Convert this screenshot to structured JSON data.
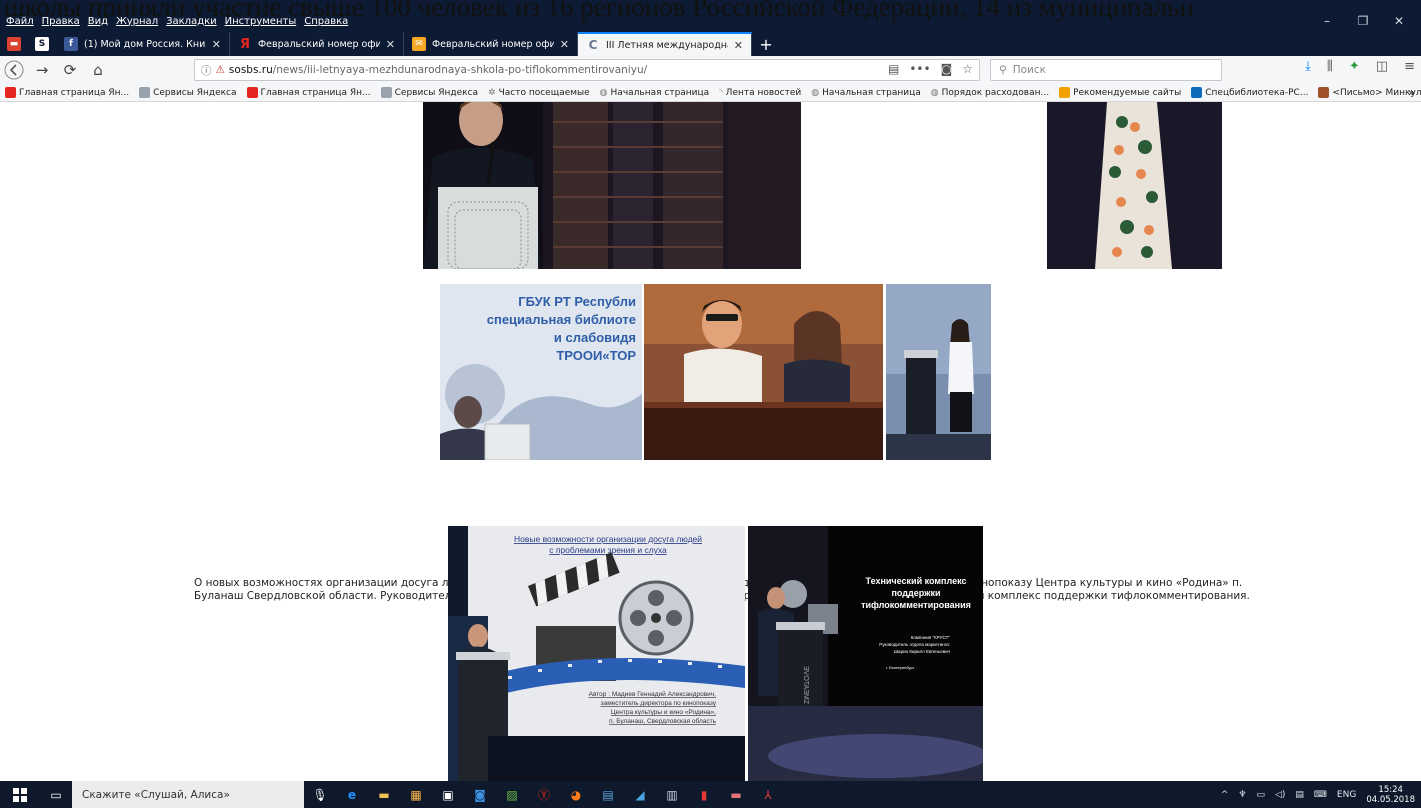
{
  "background_text": "школы приняли участие свыше 100 человек из 16 регионов Российской Федерации, 14 из муниципальн",
  "menu": [
    "Файл",
    "Правка",
    "Вид",
    "Журнал",
    "Закладки",
    "Инструменты",
    "Справка"
  ],
  "window_controls": [
    "–",
    "❐",
    "✕"
  ],
  "tabs": [
    {
      "label": "(1) Мой дом Россия. Книжны",
      "favicon": "facebook-icon",
      "color": "#3b5998"
    },
    {
      "label": "Февральский номер официал",
      "favicon": "yandex-icon",
      "color": "#e52620"
    },
    {
      "label": "Февральский номер официа",
      "favicon": "mail-icon",
      "color": "#f5a623"
    },
    {
      "label": "III Летняя международная шк",
      "favicon": "site-icon",
      "color": "#8aa0b8",
      "active": true
    }
  ],
  "url": {
    "prefix": "sosbs.ru",
    "path": "/news/iii-letnyaya-mezhdunarodnaya-shkola-po-tiflokommentirovaniyu/"
  },
  "search_placeholder": "Поиск",
  "bookmarks": [
    {
      "label": "Главная страница Ян...",
      "icon": "yandex-icon",
      "color": "#e52620"
    },
    {
      "label": "Сервисы Яндекса",
      "icon": "folder-icon",
      "color": "#9aa3ad"
    },
    {
      "label": "Главная страница Ян...",
      "icon": "yandex-icon",
      "color": "#e52620"
    },
    {
      "label": "Сервисы Яндекса",
      "icon": "folder-icon",
      "color": "#9aa3ad"
    },
    {
      "label": "Часто посещаемые",
      "icon": "gear-icon",
      "color": "#777777"
    },
    {
      "label": "Начальная страница",
      "icon": "globe-icon",
      "color": "#777777"
    },
    {
      "label": "Лента новостей",
      "icon": "rss-icon",
      "color": "#777777"
    },
    {
      "label": "Начальная страница",
      "icon": "globe-icon",
      "color": "#777777"
    },
    {
      "label": "Порядок расходован...",
      "icon": "globe-icon",
      "color": "#777777"
    },
    {
      "label": "Рекомендуемые сайты",
      "icon": "bing-icon",
      "color": "#f2a100"
    },
    {
      "label": "Спецбиблиотека-РС...",
      "icon": "outlook-icon",
      "color": "#0f6cbd"
    },
    {
      "label": "<Письмо> Минкульт...",
      "icon": "mail-icon",
      "color": "#a0522d"
    }
  ],
  "slides": {
    "gbuk": [
      "ГБУК РТ Республи",
      "специальная библиоте",
      "и слабовидя",
      "ТРООИ«ТОР"
    ],
    "left_title": [
      "Новые возможности организации досуга людей",
      "с проблемами зрения и слуха"
    ],
    "left_author": [
      "Автор : Мадиев Геннадий Александрович,",
      "заместитель директора по кинопоказу",
      "Центра культуры и кино «Родина»,",
      "п. Буланаш, Свердловская область"
    ],
    "right_title": [
      "Технический комплекс",
      "поддержки",
      "тифлокомментирования"
    ],
    "right_company": [
      "Компания \"КРУСТ\"",
      "Руководитель отдела маркетинга:",
      "Шарин Кирилл Евгеньевич"
    ],
    "right_city": "г. Екатеринбург"
  },
  "article_text": "О новых возможностях организации досуга людей с проблемами зрения и слуха рассказал Геннадий Мадиев, заместитель директора по кинопоказу Центра культуры и кино «Родина» п. Буланаш Свердловской области. Руководитель отдела маркетинга ООО «КРУСТ» Кирилл Шарин представил новую разработку: технический комплекс поддержки тифлокомментирования.",
  "taskbar": {
    "search_text": "Скажите «Слушай, Алиса»",
    "time": "15:24",
    "date": "04.05.2018",
    "language": "ENG",
    "tray_arrow": "^"
  }
}
